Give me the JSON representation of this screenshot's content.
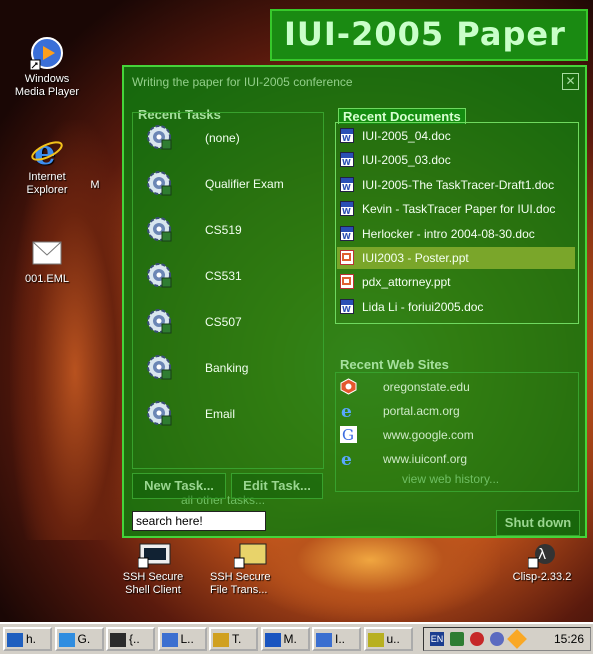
{
  "desktop": {
    "icons": [
      {
        "label": "Windows\nMedia Player",
        "icon": "media-player-icon"
      },
      {
        "label": "Internet\nExplorer",
        "icon": "internet-explorer-icon"
      },
      {
        "label": "001.EML",
        "icon": "email-file-icon"
      }
    ],
    "partial_label": "M",
    "bottom_icons": [
      {
        "label": "SSH Secure\nShell Client",
        "icon": "ssh-client-icon"
      },
      {
        "label": "SSH Secure\nFile Trans...",
        "icon": "ssh-file-transfer-icon"
      },
      {
        "label": "Clisp-2.33.2",
        "icon": "clisp-icon"
      }
    ]
  },
  "banner": {
    "title": "IUI-2005 Paper"
  },
  "panel": {
    "title": "Writing the paper for IUI-2005 conference",
    "close_glyph": "✕",
    "recent_tasks": {
      "heading": "Recent Tasks",
      "items": [
        "(none)",
        "Qualifier Exam",
        "CS519",
        "CS531",
        "CS507",
        "Banking",
        "Email"
      ],
      "all_link": "all other tasks..."
    },
    "buttons": {
      "new_task": "New Task...",
      "edit_task": "Edit Task...",
      "shut_down": "Shut down"
    },
    "search": {
      "value": "search here!"
    },
    "recent_documents": {
      "heading": "Recent Documents",
      "selected_index": 5,
      "items": [
        {
          "name": "IUI-2005_04.doc",
          "type": "word"
        },
        {
          "name": "IUI-2005_03.doc",
          "type": "word"
        },
        {
          "name": "IUI-2005-The TaskTracer-Draft1.doc",
          "type": "word"
        },
        {
          "name": "Kevin - TaskTracer Paper for IUI.doc",
          "type": "word"
        },
        {
          "name": "Herlocker - intro 2004-08-30.doc",
          "type": "word"
        },
        {
          "name": "IUI2003 - Poster.ppt",
          "type": "powerpoint"
        },
        {
          "name": "pdx_attorney.ppt",
          "type": "powerpoint"
        },
        {
          "name": "Lida Li - foriui2005.doc",
          "type": "word"
        }
      ]
    },
    "recent_web_sites": {
      "heading": "Recent Web Sites",
      "items": [
        {
          "name": "oregonstate.edu",
          "icon": "osu-icon"
        },
        {
          "name": "portal.acm.org",
          "icon": "internet-explorer-icon"
        },
        {
          "name": "www.google.com",
          "icon": "google-icon"
        },
        {
          "name": "www.iuiconf.org",
          "icon": "internet-explorer-icon"
        }
      ],
      "history_link": "view web history..."
    }
  },
  "taskbar": {
    "buttons": [
      "h.",
      "G.",
      "{..",
      "L..",
      "T.",
      "M.",
      "I..",
      "u.."
    ],
    "clock": "15:26"
  }
}
